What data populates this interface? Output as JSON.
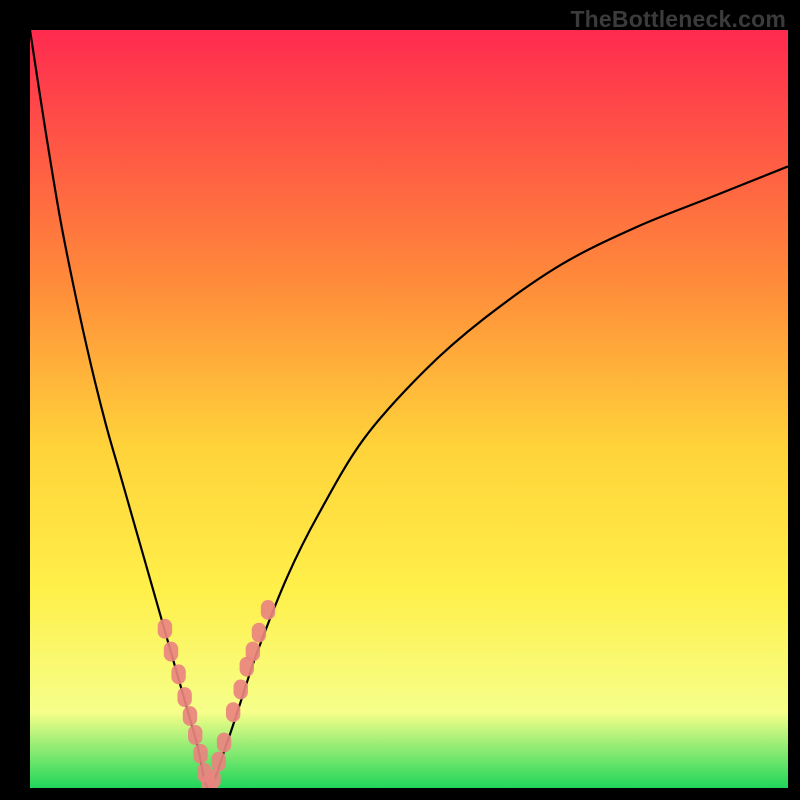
{
  "watermark": "TheBottleneck.com",
  "colors": {
    "frame": "#000000",
    "gradient_top": "#ff2a4f",
    "gradient_mid1": "#ff8a3a",
    "gradient_mid2": "#ffd33a",
    "gradient_mid3": "#fff04a",
    "gradient_low": "#f6ff8a",
    "gradient_bottom": "#1fd65a",
    "curve": "#000000",
    "markers_fill": "#e9847f",
    "markers_stroke": "#e9847f"
  },
  "chart_data": {
    "type": "line",
    "title": "",
    "xlabel": "",
    "ylabel": "",
    "xlim": [
      0,
      100
    ],
    "ylim": [
      0,
      100
    ],
    "grid": false,
    "legend": false,
    "series": [
      {
        "name": "bottleneck-curve",
        "x": [
          0,
          2,
          4,
          6,
          8,
          10,
          12,
          14,
          16,
          18,
          20,
          22,
          23.6,
          26,
          28,
          30,
          34,
          38,
          44,
          52,
          60,
          70,
          80,
          90,
          100
        ],
        "y": [
          100,
          87,
          75,
          65,
          56,
          48,
          41,
          34,
          27,
          20,
          13,
          6,
          0,
          6,
          12,
          18,
          28,
          36,
          46,
          55,
          62,
          69,
          74,
          78,
          82
        ]
      }
    ],
    "annotations": {
      "minimum_x": 23.6,
      "minimum_y": 0
    },
    "markers": {
      "name": "highlight-beads",
      "points": [
        {
          "x": 17.8,
          "y": 21
        },
        {
          "x": 18.6,
          "y": 18
        },
        {
          "x": 19.6,
          "y": 15
        },
        {
          "x": 20.4,
          "y": 12
        },
        {
          "x": 21.1,
          "y": 9.5
        },
        {
          "x": 21.8,
          "y": 7
        },
        {
          "x": 22.5,
          "y": 4.5
        },
        {
          "x": 23.0,
          "y": 2
        },
        {
          "x": 23.6,
          "y": 0.5
        },
        {
          "x": 24.2,
          "y": 1.2
        },
        {
          "x": 24.9,
          "y": 3.5
        },
        {
          "x": 25.6,
          "y": 6
        },
        {
          "x": 26.8,
          "y": 10
        },
        {
          "x": 27.8,
          "y": 13
        },
        {
          "x": 28.6,
          "y": 16
        },
        {
          "x": 29.4,
          "y": 18
        },
        {
          "x": 30.2,
          "y": 20.5
        },
        {
          "x": 31.4,
          "y": 23.5
        }
      ],
      "radius_px": 9
    }
  }
}
